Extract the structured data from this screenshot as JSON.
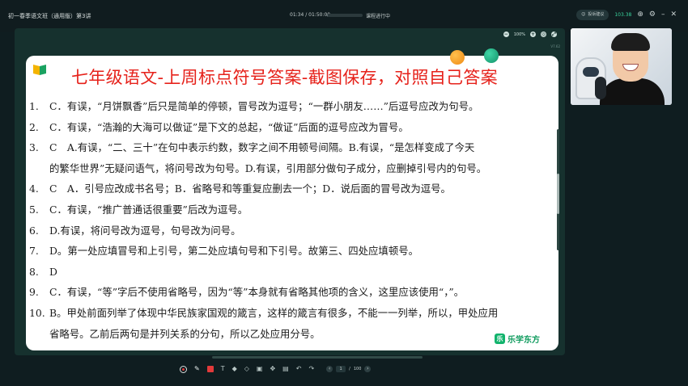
{
  "header": {
    "course_title": "初一春季语文班（通用版）第3讲",
    "time_current": "01:34",
    "time_total": "01:50:00",
    "time_separator": "/",
    "progress_fraction": 0.02,
    "status": "课程进行中",
    "report_label": "投诉建议",
    "net_speed": "103.38"
  },
  "slide": {
    "zoom_level": "100%",
    "code": "V7.62",
    "title": "七年级语文-上周标点符号答案-截图保存，对照自己答案",
    "answers": [
      {
        "num": "1.",
        "text": "C．有误，“月饼飘香”后只是简单的停顿，冒号改为逗号；“一群小朋友……”后逗号应改为句号。"
      },
      {
        "num": "2.",
        "text": "C．有误，“浩瀚的大海可以做证”是下文的总起，“做证”后面的逗号应改为冒号。"
      },
      {
        "num": "3.",
        "text": "C　A.有误，“二、三十”在句中表示约数，数字之间不用顿号间隔。B.有误，“是怎样变成了今天"
      },
      {
        "num": "",
        "text": "的繁华世界”无疑问语气，将问号改为句号。D.有误，引用部分做句子成分，应删掉引号内的句号。"
      },
      {
        "num": "4.",
        "text": "C　A．引号应改成书名号；B．省略号和等重复应删去一个；D．说后面的冒号改为逗号。"
      },
      {
        "num": "5.",
        "text": "C．有误，“推广普通话很重要”后改为逗号。"
      },
      {
        "num": "6.",
        "text": "D.有误，将问号改为逗号，句号改为问号。"
      },
      {
        "num": "7.",
        "text": "D。第一处应填冒号和上引号，第二处应填句号和下引号。故第三、四处应填顿号。"
      },
      {
        "num": "8.",
        "text": "D"
      },
      {
        "num": "9.",
        "text": "C．有误，“等”字后不使用省略号，因为“等”本身就有省略其他项的含义，这里应该使用“，”。"
      },
      {
        "num": "10.",
        "text": "B。甲处前面列举了体现中华民族家国观的箴言，这样的箴言有很多，不能一一列举，所以，甲处应用"
      },
      {
        "num": "",
        "text": "省略号。乙前后两句是并列关系的分句，所以乙处应用分号。"
      }
    ],
    "brand": "乐学东方",
    "brand_mark": "乐"
  },
  "footer": {
    "page_current": "1",
    "page_total": "100",
    "page_separator": "/"
  },
  "colors": {
    "title_red": "#e6221b",
    "brand_green": "#0e9b5d",
    "slide_bg": "#16312e",
    "app_bg": "#0f1d20"
  },
  "icons": [
    "report-icon",
    "search-icon",
    "settings-icon",
    "minimize-icon",
    "close-icon",
    "zoom-in-icon",
    "zoom-out-icon",
    "fit-icon",
    "fullscreen-icon",
    "book-icon",
    "record-icon",
    "pen-icon",
    "color-icon",
    "text-icon",
    "eraser-icon",
    "shape-icon",
    "clear-icon",
    "move-icon",
    "undo-icon",
    "redo-icon",
    "prev-page-icon",
    "next-page-icon"
  ]
}
